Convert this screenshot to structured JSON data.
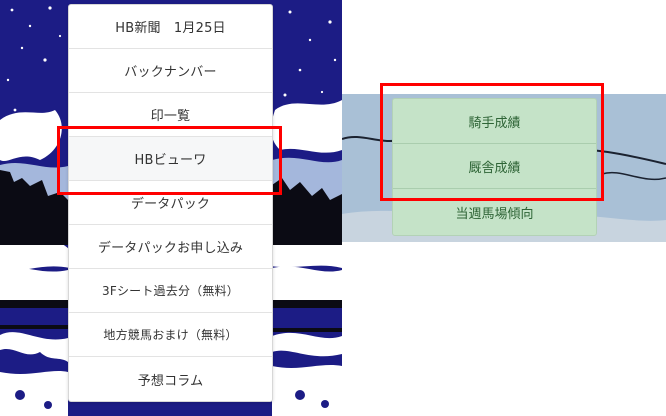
{
  "left_menu": {
    "items": [
      "HB新聞　1月25日",
      "バックナンバー",
      "印一覧",
      "HBビューワ",
      "データパック",
      "データパックお申し込み",
      "3Fシート過去分（無料）",
      "地方競馬おまけ（無料）",
      "予想コラム"
    ],
    "highlighted_index": 3
  },
  "right_menu": {
    "items": [
      "騎手成績",
      "厩舎成績",
      "当週馬場傾向"
    ],
    "highlighted_range": [
      0,
      1
    ]
  },
  "colors": {
    "highlight_border": "#ff0000",
    "submenu_bg": "#c5e3c8",
    "submenu_text": "#2e6436",
    "night_sky": "#1c1c85",
    "right_panel_bg": "#a9c0d6"
  }
}
